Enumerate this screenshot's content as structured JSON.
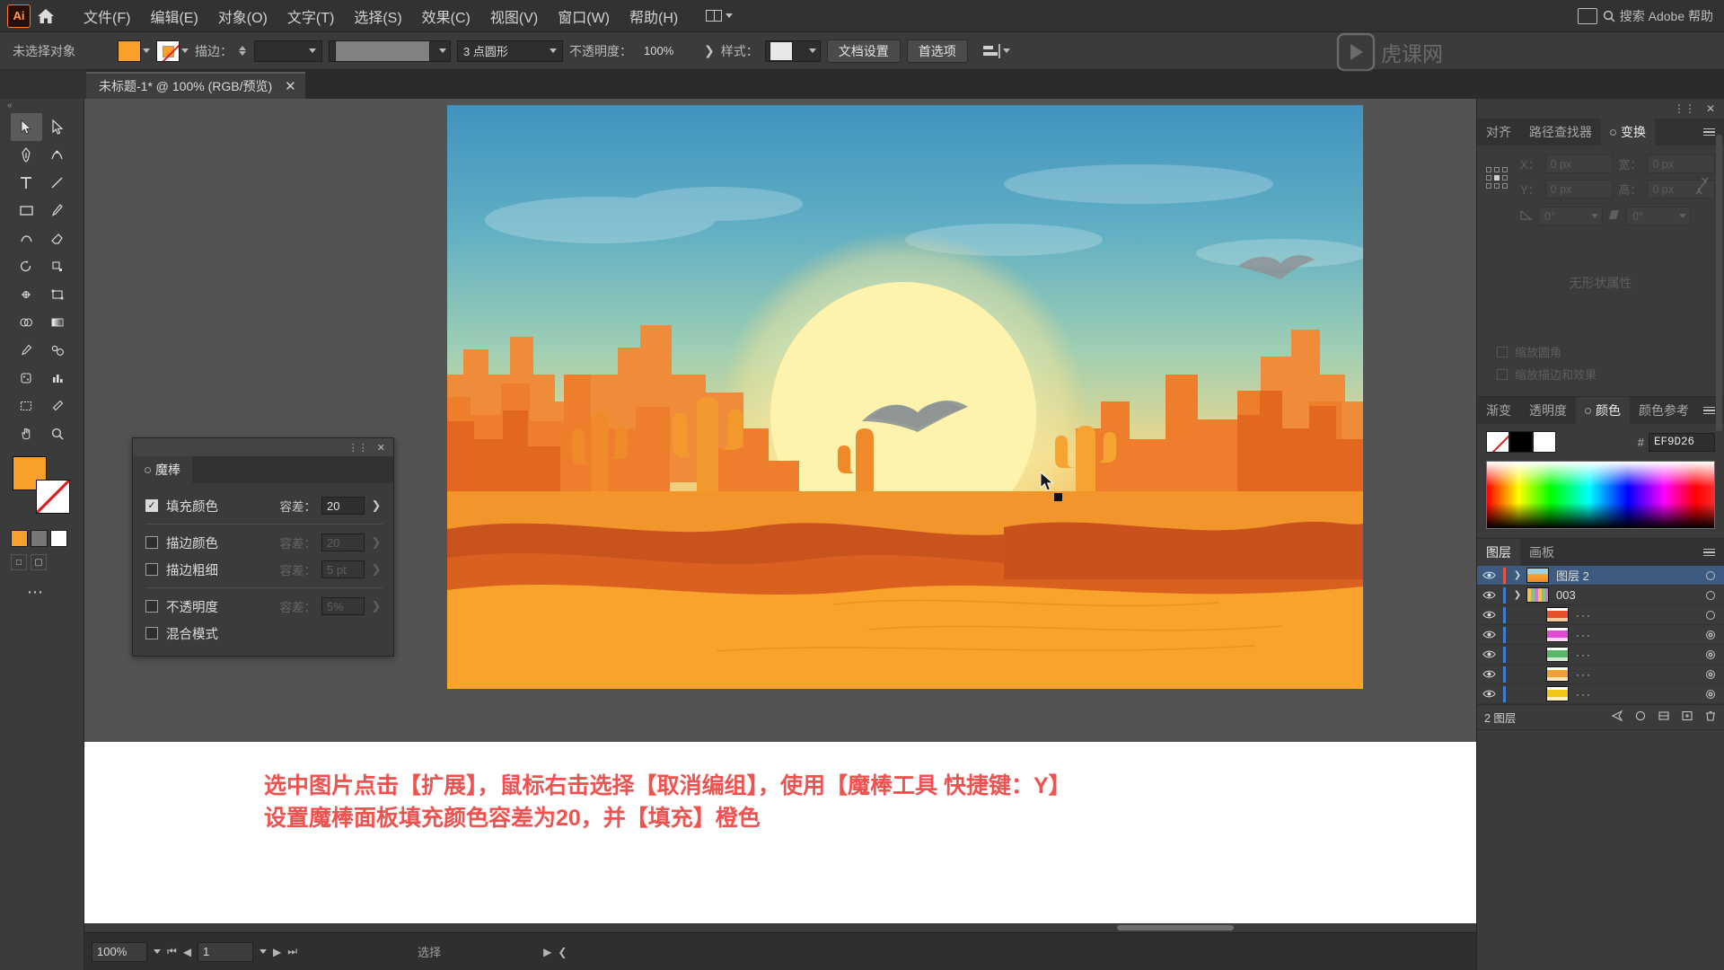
{
  "app": {
    "name": "Adobe Illustrator",
    "logo_text": "Ai",
    "home_icon": "home-icon"
  },
  "menubar": {
    "items": [
      {
        "label": "文件(F)"
      },
      {
        "label": "编辑(E)"
      },
      {
        "label": "对象(O)"
      },
      {
        "label": "文字(T)"
      },
      {
        "label": "选择(S)"
      },
      {
        "label": "效果(C)"
      },
      {
        "label": "视图(V)"
      },
      {
        "label": "窗口(W)"
      },
      {
        "label": "帮助(H)"
      }
    ],
    "arrange_icon": "arrange-documents-icon",
    "search_placeholder": "搜索 Adobe 帮助",
    "search_icon": "search-icon",
    "window_icon": "window-layout-icon"
  },
  "controlbar": {
    "selection_status": "未选择对象",
    "fill_swatch_color": "#f9a02b",
    "stroke_label": "描边：",
    "stroke_weight_value": "",
    "stroke_profile": "3 点圆形",
    "opacity_label": "不透明度：",
    "opacity_value": "100%",
    "style_label": "样式：",
    "doc_setup_button": "文档设置",
    "preferences_button": "首选项",
    "align_icon": "align-icon"
  },
  "tabbar": {
    "document_title": "未标题-1* @ 100% (RGB/预览)",
    "close_icon": "close-icon"
  },
  "toolbar": {
    "tools": [
      {
        "name": "selection-tool",
        "active": true
      },
      {
        "name": "direct-selection-tool",
        "active": false
      },
      {
        "name": "magic-wand-tool",
        "active": false
      },
      {
        "name": "lasso-tool",
        "active": false
      },
      {
        "name": "pen-tool",
        "active": false
      },
      {
        "name": "curvature-tool",
        "active": false
      },
      {
        "name": "type-tool",
        "active": false
      },
      {
        "name": "line-segment-tool",
        "active": false
      },
      {
        "name": "rectangle-tool",
        "active": false
      },
      {
        "name": "paintbrush-tool",
        "active": false
      },
      {
        "name": "shaper-tool",
        "active": false
      },
      {
        "name": "eraser-tool",
        "active": false
      },
      {
        "name": "rotate-tool",
        "active": false
      },
      {
        "name": "scale-tool",
        "active": false
      },
      {
        "name": "width-tool",
        "active": false
      },
      {
        "name": "free-transform-tool",
        "active": false
      },
      {
        "name": "shape-builder-tool",
        "active": false
      },
      {
        "name": "gradient-tool",
        "active": false
      },
      {
        "name": "eyedropper-tool",
        "active": false
      },
      {
        "name": "blend-tool",
        "active": false
      },
      {
        "name": "symbol-sprayer-tool",
        "active": false
      },
      {
        "name": "column-graph-tool",
        "active": false
      },
      {
        "name": "artboard-tool",
        "active": false
      },
      {
        "name": "slice-tool",
        "active": false
      },
      {
        "name": "hand-tool",
        "active": false
      },
      {
        "name": "zoom-tool",
        "active": false
      }
    ],
    "fill_color": "#f9a02b",
    "stroke_color": "#ffffff",
    "more_icon": "more-tools-icon"
  },
  "wand_panel": {
    "tab_label": "魔棒",
    "collapse_icon": "collapse-icon",
    "close_icon": "close-icon",
    "rows": [
      {
        "label": "填充颜色",
        "checked": true,
        "tol_label": "容差：",
        "tol_value": "20",
        "enabled": true
      },
      {
        "label": "描边颜色",
        "checked": false,
        "tol_label": "容差：",
        "tol_value": "20",
        "enabled": false
      },
      {
        "label": "描边粗细",
        "checked": false,
        "tol_label": "容差：",
        "tol_value": "5 pt",
        "enabled": false
      },
      {
        "label": "不透明度",
        "checked": false,
        "tol_label": "容差：",
        "tol_value": "5%",
        "enabled": false
      },
      {
        "label": "混合模式",
        "checked": false,
        "tol_label": "",
        "tol_value": "",
        "enabled": false
      }
    ]
  },
  "transform_panel": {
    "titlebar_collapse_icon": "collapse-icon",
    "titlebar_close_icon": "close-icon",
    "tabs": [
      {
        "label": "对齐",
        "active": false
      },
      {
        "label": "路径查找器",
        "active": false
      },
      {
        "label": "变换",
        "active": true
      }
    ],
    "menu_icon": "panel-menu-icon",
    "fields": [
      {
        "label": "X：",
        "value": "0 px"
      },
      {
        "label": "宽：",
        "value": "0 px"
      },
      {
        "label": "Y：",
        "value": "0 px"
      },
      {
        "label": "高：",
        "value": "0 px"
      }
    ],
    "angle_label": "角度",
    "angle_value": "0°",
    "shear_label": "倾斜",
    "shear_value": "0°",
    "link_icon": "link-broken-icon",
    "empty_text": "无形状属性",
    "checkboxes": [
      {
        "label": "缩放圆角",
        "checked": false
      },
      {
        "label": "缩放描边和效果",
        "checked": false
      }
    ]
  },
  "color_panel": {
    "tabs": [
      {
        "label": "渐变",
        "active": false
      },
      {
        "label": "透明度",
        "active": false
      },
      {
        "label": "颜色",
        "active": true
      },
      {
        "label": "颜色参考",
        "active": false
      }
    ],
    "menu_icon": "panel-menu-icon",
    "hex_prefix": "#",
    "hex_value": "EF9D26",
    "swatches": [
      "none",
      "#000000",
      "#ffffff"
    ]
  },
  "layers_panel": {
    "tabs": [
      {
        "label": "图层",
        "active": true
      },
      {
        "label": "画板",
        "active": false
      }
    ],
    "menu_icon": "panel-menu-icon",
    "rows": [
      {
        "name": "图层 2",
        "indent": 0,
        "selected": true,
        "twisty": "collapsed",
        "thumb": "artwork",
        "bar_color": "#e8553c",
        "dots": false,
        "target_double": false
      },
      {
        "name": "003",
        "indent": 0,
        "selected": false,
        "twisty": "expanded",
        "thumb": "group",
        "bar_color": "#3d7fd6",
        "dots": false,
        "target_double": false
      },
      {
        "name": "",
        "indent": 1,
        "selected": false,
        "twisty": "none",
        "thumb": "#e8502a",
        "bar_color": "#3d7fd6",
        "dots": true,
        "target_double": false
      },
      {
        "name": "",
        "indent": 1,
        "selected": false,
        "twisty": "none",
        "thumb": "#e24ad2",
        "bar_color": "#3d7fd6",
        "dots": true,
        "target_double": true
      },
      {
        "name": "",
        "indent": 1,
        "selected": false,
        "twisty": "none",
        "thumb": "#57b76a",
        "bar_color": "#3d7fd6",
        "dots": true,
        "target_double": true
      },
      {
        "name": "",
        "indent": 1,
        "selected": false,
        "twisty": "none",
        "thumb": "#f0a12e",
        "bar_color": "#3d7fd6",
        "dots": true,
        "target_double": true
      },
      {
        "name": "",
        "indent": 1,
        "selected": false,
        "twisty": "none",
        "thumb": "#f3c516",
        "bar_color": "#3d7fd6",
        "dots": true,
        "target_double": true
      }
    ],
    "footer_count": "2 图层",
    "footer_icons": [
      "locate-object-icon",
      "make-clipping-mask-icon",
      "create-sublayer-icon",
      "new-layer-icon",
      "delete-layer-icon"
    ]
  },
  "caption": {
    "text": "选中图片点击【扩展】，鼠标右击选择【取消编组】，使用【魔棒工具 快捷键：Y】\n设置魔棒面板填充颜色容差为20，并【填充】橙色",
    "color": "#f0534f"
  },
  "statusbar": {
    "zoom": "100%",
    "page": "1",
    "status_text": "选择",
    "first_icon": "first-page-icon",
    "prev_icon": "previous-page-icon",
    "next_icon": "next-page-icon",
    "last_icon": "last-page-icon"
  },
  "artwork": {
    "description": "desert-sunset-illustration",
    "sky_top": "#4a9ec4",
    "sun_color": "#fdf0a8",
    "sand_color": "#f9a02b",
    "mesa_color": "#e8742b",
    "shadow_color": "#c94e1d"
  },
  "watermark": {
    "text": "虎课网"
  }
}
